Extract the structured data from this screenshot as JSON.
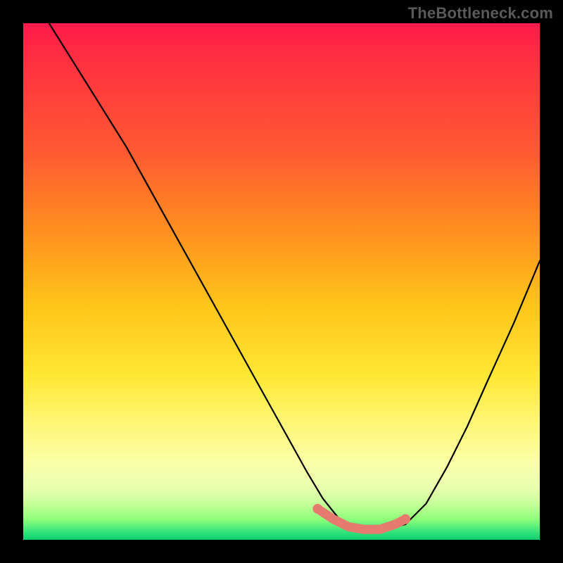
{
  "watermark": "TheBottleneck.com",
  "chart_data": {
    "type": "line",
    "title": "",
    "xlabel": "",
    "ylabel": "",
    "xlim": [
      0,
      100
    ],
    "ylim": [
      0,
      100
    ],
    "grid": false,
    "legend": false,
    "description": "Bottleneck curve with vertical gradient background (red=high bottleneck at top, green=low bottleneck at bottom). A black V-shaped curve descends steeply from upper-left, reaches a flat minimum around x≈62-72 near y≈2, then rises toward the right edge. A salmon-colored highlight marks the optimal flat region.",
    "series": [
      {
        "name": "bottleneck-curve",
        "color": "#000000",
        "x": [
          5,
          10,
          15,
          20,
          25,
          30,
          35,
          40,
          45,
          50,
          55,
          58,
          62,
          66,
          70,
          74,
          78,
          82,
          86,
          90,
          95,
          100
        ],
        "y": [
          100,
          92,
          84,
          76,
          67,
          58,
          49,
          40,
          31,
          22,
          13,
          8,
          3,
          2,
          2,
          3,
          7,
          14,
          22,
          31,
          42,
          54
        ]
      },
      {
        "name": "optimal-highlight",
        "color": "#e77a6f",
        "x": [
          57,
          60,
          63,
          66,
          69,
          72,
          74
        ],
        "y": [
          6,
          4,
          2.5,
          2,
          2,
          3,
          4
        ]
      }
    ],
    "optimal_point": {
      "x": 67,
      "y": 2
    }
  }
}
